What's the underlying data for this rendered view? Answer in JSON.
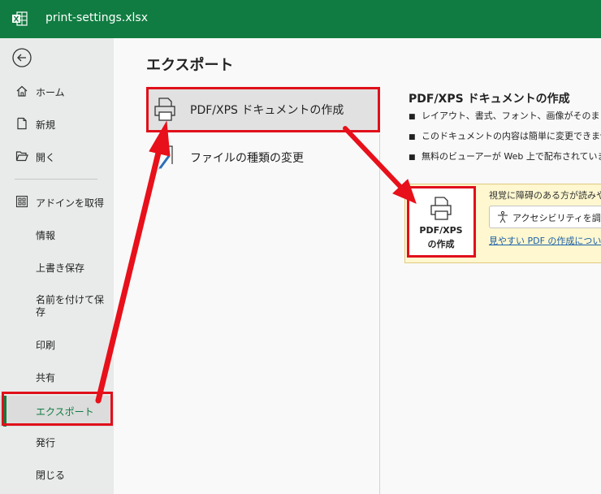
{
  "window": {
    "filename": "print-settings.xlsx"
  },
  "sidebar": {
    "items": [
      {
        "label": "ホーム",
        "icon": "home-icon"
      },
      {
        "label": "新規",
        "icon": "new-document-icon"
      },
      {
        "label": "開く",
        "icon": "folder-open-icon"
      },
      {
        "label": "アドインを取得",
        "icon": "addins-grid-icon"
      },
      {
        "label": "情報"
      },
      {
        "label": "上書き保存"
      },
      {
        "label": "名前を付けて保存"
      },
      {
        "label": "印刷"
      },
      {
        "label": "共有"
      },
      {
        "label": "エクスポート",
        "selected": true
      },
      {
        "label": "発行"
      },
      {
        "label": "閉じる"
      }
    ]
  },
  "main": {
    "title": "エクスポート",
    "options": [
      {
        "label": "PDF/XPS ドキュメントの作成",
        "icon": "printer-icon",
        "active": true
      },
      {
        "label": "ファイルの種類の変更",
        "icon": "file-change-icon"
      }
    ],
    "detail": {
      "title": "PDF/XPS ドキュメントの作成",
      "bullets": [
        "レイアウト、書式、フォント、画像がそのまま維持",
        "このドキュメントの内容は簡単に変更できません",
        "無料のビューアーが Web 上で配布されています"
      ],
      "callout": {
        "button_line1": "PDF/XPS",
        "button_line2": "の作成",
        "text": "視覚に障碍のある方が読みや",
        "accessibility_button": "アクセシビリティを調べ",
        "link": "見やすい PDF の作成につい"
      }
    }
  },
  "colors": {
    "brand": "#107c41",
    "highlight": "#e0101b",
    "callout_bg": "#fef7cf",
    "link": "#1a5fa8"
  }
}
